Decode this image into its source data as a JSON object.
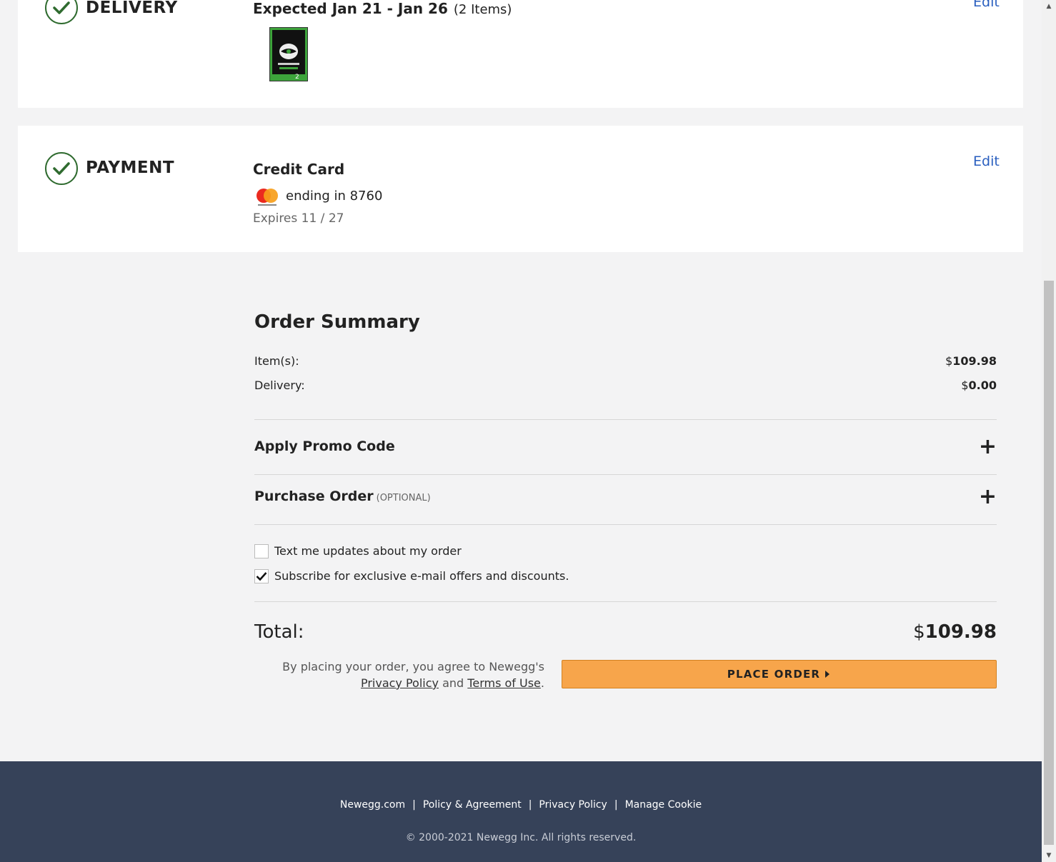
{
  "delivery": {
    "title": "DELIVERY",
    "expected": "Expected Jan 21 - Jan 26",
    "item_count": "(2 Items)",
    "edit_label": "Edit",
    "product_icon": "hard-drive-product-image"
  },
  "payment": {
    "title": "PAYMENT",
    "method": "Credit Card",
    "card_brand": "mastercard",
    "ending": "ending in 8760",
    "expires": "Expires 11 / 27",
    "edit_label": "Edit"
  },
  "summary": {
    "title": "Order Summary",
    "items_label": "Item(s):",
    "items_currency": "$",
    "items_value": "109.98",
    "delivery_label": "Delivery:",
    "delivery_currency": "$",
    "delivery_value": "0.00",
    "promo_label": "Apply Promo Code",
    "po_label": "Purchase Order",
    "po_optional": "(OPTIONAL)",
    "text_updates_label": "Text me updates about my order",
    "text_updates_checked": false,
    "subscribe_label": "Subscribe for exclusive e-mail offers and discounts.",
    "subscribe_checked": true,
    "total_label": "Total:",
    "total_currency": "$",
    "total_value": "109.98",
    "agree_prefix": "By placing your order, you agree to Newegg's",
    "privacy_link": "Privacy Policy",
    "agree_and": "and",
    "terms_link": "Terms of Use",
    "agree_suffix": ".",
    "place_order_label": "PLACE ORDER"
  },
  "footer": {
    "links": [
      "Newegg.com",
      "Policy & Agreement",
      "Privacy Policy",
      "Manage Cookie"
    ],
    "copyright": "© 2000-2021 Newegg Inc. All rights reserved."
  },
  "colors": {
    "accent_link": "#2a5fbf",
    "check_green": "#2f6b2f",
    "button_orange": "#f7a54b",
    "footer_bg": "#364259"
  }
}
